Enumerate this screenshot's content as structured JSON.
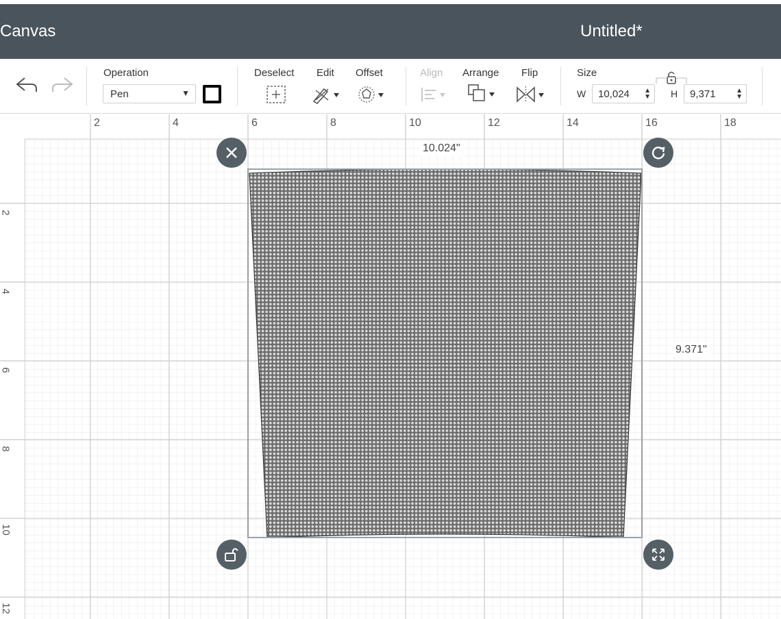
{
  "titlebar": {
    "app_title": "Canvas",
    "document_title": "Untitled*",
    "background": "#4a545c"
  },
  "toolbar": {
    "undo_icon": "undo-arrow-icon",
    "redo_icon": "redo-arrow-icon",
    "operation": {
      "label": "Operation",
      "value": "Pen",
      "swatch_color": "#000000"
    },
    "deselect_label": "Deselect",
    "edit_label": "Edit",
    "offset_label": "Offset",
    "align_label": "Align",
    "arrange_label": "Arrange",
    "flip_label": "Flip",
    "size": {
      "label": "Size",
      "w_label": "W",
      "w_value": "10,024",
      "h_label": "H",
      "h_value": "9,371",
      "lock_icon": "lock-open-icon"
    }
  },
  "ruler": {
    "top_labels": [
      "2",
      "4",
      "6",
      "8",
      "10",
      "12",
      "14",
      "16",
      "18"
    ],
    "left_labels": [
      "2",
      "4",
      "6",
      "8",
      "10",
      "12"
    ]
  },
  "selection": {
    "width_label": "10.024\"",
    "height_label": "9.371\"",
    "handles": [
      "close-icon",
      "rotate-icon",
      "lock-icon",
      "resize-icon"
    ]
  }
}
